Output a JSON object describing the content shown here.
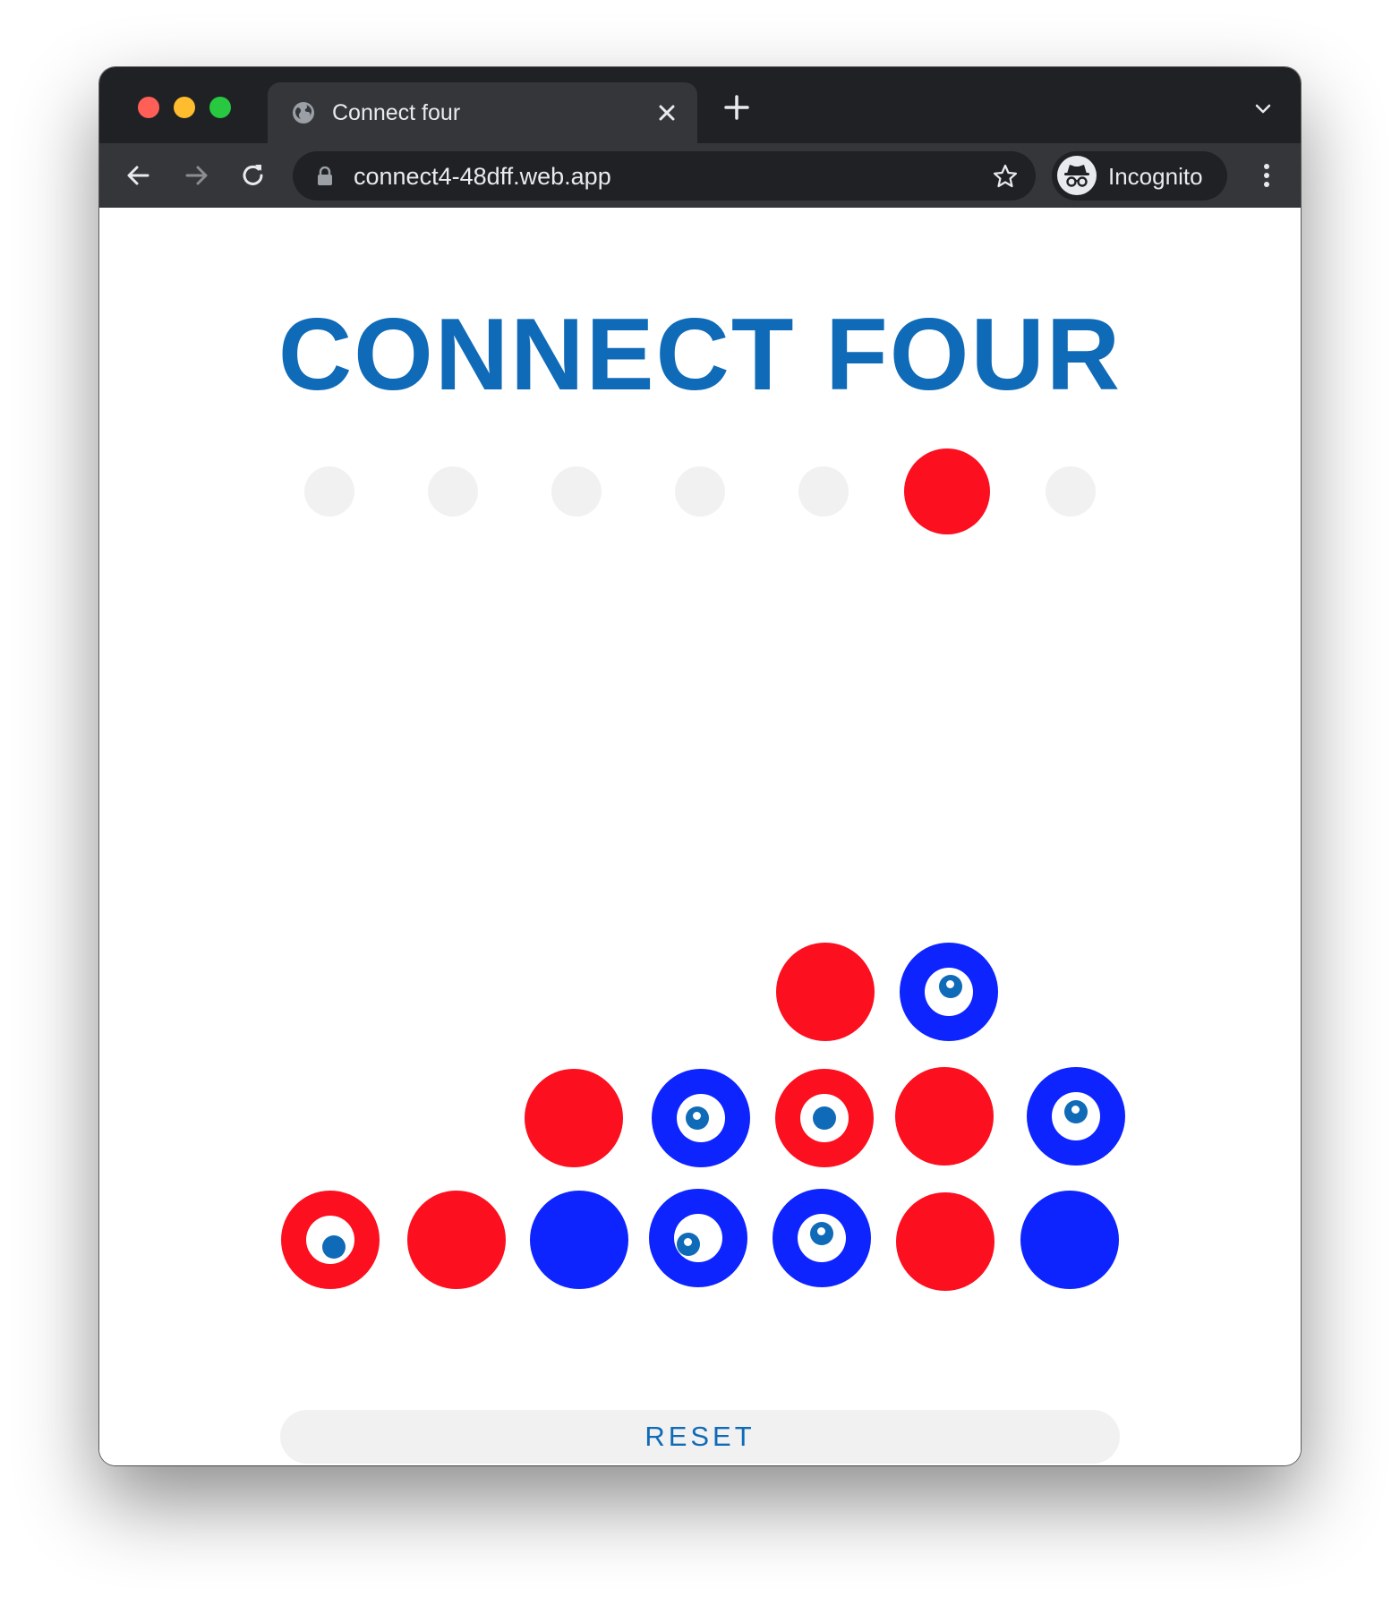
{
  "browser": {
    "tab": {
      "title": "Connect four",
      "favicon": "globe-icon"
    },
    "address_bar": {
      "url": "connect4-48dff.web.app",
      "lock": "lock-icon"
    },
    "profile": {
      "label": "Incognito",
      "icon": "incognito-icon"
    },
    "colors": {
      "frame": "#202124",
      "toolbar": "#35363a"
    }
  },
  "game": {
    "title": "CONNECT FOUR",
    "active_player": "red",
    "hover_column": 5,
    "columns": 7,
    "rows_shown": 3,
    "board_bottom_up": [
      [
        "red",
        "red",
        "blue",
        "blue",
        "blue",
        "red",
        "blue"
      ],
      [
        null,
        null,
        "red",
        "blue",
        "red",
        "red",
        "blue"
      ],
      [
        null,
        null,
        null,
        null,
        "red",
        "blue",
        null
      ]
    ],
    "eye_pieces": [
      "bottom col 1",
      "bottom col 4",
      "bottom col 5",
      "middle col 4",
      "middle col 5",
      "middle col 7",
      "top col 6"
    ],
    "reset_label": "RESET",
    "colors": {
      "red": "#fc0f1f",
      "blue": "#0d24ff",
      "title": "#0f6ab8",
      "slot": "#f1f1f1"
    }
  }
}
